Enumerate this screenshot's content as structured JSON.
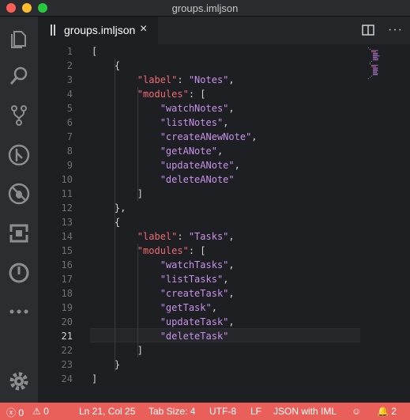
{
  "window": {
    "title": "groups.imljson"
  },
  "activity_bar": {
    "icons": [
      "explorer-icon",
      "search-icon",
      "source-control-icon",
      "debug-icon",
      "extensions-bug-icon",
      "remote-box-icon",
      "power-icon",
      "more-icon"
    ],
    "settings_icon": "gear-icon"
  },
  "tab": {
    "label": "groups.imljson",
    "close": "×"
  },
  "editor_actions": {
    "more": "···"
  },
  "editor": {
    "active_line": 21,
    "lines": [
      {
        "n": "1",
        "text": "["
      },
      {
        "n": "2",
        "text": "    {"
      },
      {
        "n": "3",
        "key": "\"label\"",
        "sep": ": ",
        "str": "\"Notes\"",
        "tail": ",",
        "indent": "        "
      },
      {
        "n": "4",
        "key": "\"modules\"",
        "sep": ": ",
        "tail": "[",
        "indent": "        "
      },
      {
        "n": "5",
        "str": "\"watchNotes\"",
        "tail": ",",
        "indent": "            "
      },
      {
        "n": "6",
        "str": "\"listNotes\"",
        "tail": ",",
        "indent": "            "
      },
      {
        "n": "7",
        "str": "\"createANewNote\"",
        "tail": ",",
        "indent": "            "
      },
      {
        "n": "8",
        "str": "\"getANote\"",
        "tail": ",",
        "indent": "            "
      },
      {
        "n": "9",
        "str": "\"updateANote\"",
        "tail": ",",
        "indent": "            "
      },
      {
        "n": "10",
        "str": "\"deleteANote\"",
        "tail": "",
        "indent": "            "
      },
      {
        "n": "11",
        "text": "        ]"
      },
      {
        "n": "12",
        "text": "    },"
      },
      {
        "n": "13",
        "text": "    {"
      },
      {
        "n": "14",
        "key": "\"label\"",
        "sep": ": ",
        "str": "\"Tasks\"",
        "tail": ",",
        "indent": "        "
      },
      {
        "n": "15",
        "key": "\"modules\"",
        "sep": ": ",
        "tail": "[",
        "indent": "        "
      },
      {
        "n": "16",
        "str": "\"watchTasks\"",
        "tail": ",",
        "indent": "            "
      },
      {
        "n": "17",
        "str": "\"listTasks\"",
        "tail": ",",
        "indent": "            "
      },
      {
        "n": "18",
        "str": "\"createTask\"",
        "tail": ",",
        "indent": "            "
      },
      {
        "n": "19",
        "str": "\"getTask\"",
        "tail": ",",
        "indent": "            "
      },
      {
        "n": "20",
        "str": "\"updateTask\"",
        "tail": ",",
        "indent": "            "
      },
      {
        "n": "21",
        "str": "\"deleteTask\"",
        "tail": "",
        "indent": "            "
      },
      {
        "n": "22",
        "text": "        ]"
      },
      {
        "n": "23",
        "text": "    }"
      },
      {
        "n": "24",
        "text": "]"
      }
    ]
  },
  "status_bar": {
    "errors": "0",
    "warnings": "0",
    "position": "Ln 21, Col 25",
    "tab_size": "Tab Size: 4",
    "encoding": "UTF-8",
    "eol": "LF",
    "language": "JSON with IML",
    "notifications": "2",
    "background": "#e9605a"
  },
  "colors": {
    "key": "#ef6b73",
    "string": "#c792ea",
    "background": "#1e1f22"
  }
}
